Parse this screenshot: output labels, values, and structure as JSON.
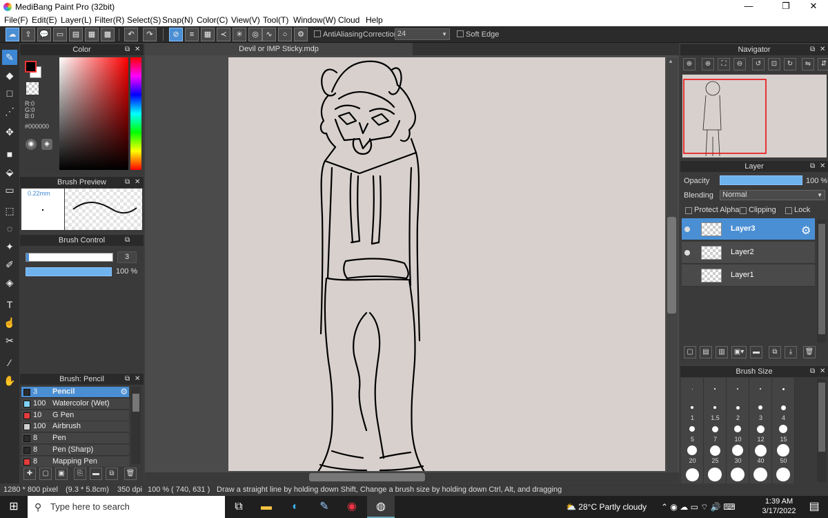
{
  "window": {
    "title": "MediBang Paint Pro (32bit)",
    "minimize": "—",
    "maximize": "❐",
    "close": "✕"
  },
  "menu": [
    "File(F)",
    "Edit(E)",
    "Layer(L)",
    "Filter(R)",
    "Select(S)",
    "Snap(N)",
    "Color(C)",
    "View(V)",
    "Tool(T)",
    "Window(W)",
    "Cloud",
    "Help"
  ],
  "toolbar": {
    "antialiasing_label": "AntiAliasing",
    "correction_label": "Correction",
    "correction_value": "24",
    "soft_edge_label": "Soft Edge"
  },
  "color_panel": {
    "title": "Color",
    "r": "R:0",
    "g": "G:0",
    "b": "B:0",
    "hex": "#000000",
    "fg_color": "#000000"
  },
  "brush_preview": {
    "title": "Brush Preview",
    "size": "0.22mm"
  },
  "brush_control": {
    "title": "Brush Control",
    "size_value": "3",
    "opacity_value": "100 %"
  },
  "brush_list": {
    "title": "Brush: Pencil",
    "items": [
      {
        "size": "3",
        "name": "Pencil",
        "color": "#2b2b2b",
        "selected": true
      },
      {
        "size": "100",
        "name": "Watercolor (Wet)",
        "color": "#7fd3f7",
        "selected": false
      },
      {
        "size": "10",
        "name": "G Pen",
        "color": "#e33c3c",
        "selected": false
      },
      {
        "size": "100",
        "name": "Airbrush",
        "color": "#cfcfcf",
        "selected": false
      },
      {
        "size": "8",
        "name": "Pen",
        "color": "#2b2b2b",
        "selected": false
      },
      {
        "size": "8",
        "name": "Pen (Sharp)",
        "color": "#2b2b2b",
        "selected": false
      },
      {
        "size": "8",
        "name": "Mapping Pen",
        "color": "#e33c3c",
        "selected": false
      }
    ]
  },
  "document": {
    "tab_title": "Devil or IMP Sticky.mdp"
  },
  "navigator": {
    "title": "Navigator"
  },
  "layer_panel": {
    "title": "Layer",
    "opacity_label": "Opacity",
    "opacity_value": "100 %",
    "opacity_fraction": 1.0,
    "blending_label": "Blending",
    "blending_value": "Normal",
    "protect_alpha_label": "Protect Alpha",
    "clipping_label": "Clipping",
    "lock_label": "Lock",
    "layers": [
      {
        "name": "Layer3",
        "selected": true,
        "visible": true
      },
      {
        "name": "Layer2",
        "selected": false,
        "visible": true
      },
      {
        "name": "Layer1",
        "selected": false,
        "visible": false
      }
    ]
  },
  "brush_size_panel": {
    "title": "Brush Size",
    "sizes": [
      "",
      "",
      "",
      "",
      "",
      "1",
      "1.5",
      "2",
      "3",
      "4",
      "5",
      "7",
      "10",
      "12",
      "15",
      "20",
      "25",
      "30",
      "40",
      "50",
      "",
      "",
      "",
      "",
      ""
    ]
  },
  "status": {
    "dims": "1280 * 800 pixel",
    "cm": "(9.3 * 5.8cm)",
    "dpi": "350 dpi",
    "zoom": "100 %",
    "coords": "( 740, 631 )",
    "hint": "Draw a straight line by holding down Shift, Change a brush size by holding down Ctrl, Alt, and dragging"
  },
  "taskbar": {
    "search_placeholder": "Type here to search",
    "weather": "28°C  Partly cloudy",
    "time": "1:39 AM",
    "date": "3/17/2022"
  }
}
